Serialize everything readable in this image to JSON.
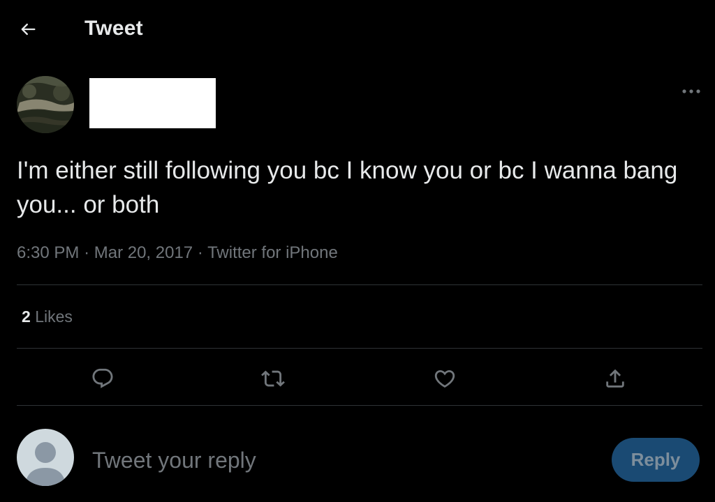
{
  "header": {
    "title": "Tweet",
    "back_icon": "arrow-left-icon"
  },
  "tweet": {
    "avatar_icon": "profile-photo",
    "text": "I'm either still following you bc I know you or bc I wanna bang you... or both",
    "time": "6:30 PM",
    "separator": "·",
    "date": "Mar 20, 2017",
    "source": "Twitter for iPhone",
    "more_icon": "more-horizontal-icon"
  },
  "stats": {
    "likes_count": "2",
    "likes_label": "Likes"
  },
  "actions": [
    {
      "icon": "reply-icon"
    },
    {
      "icon": "retweet-icon"
    },
    {
      "icon": "heart-icon"
    },
    {
      "icon": "share-icon"
    }
  ],
  "composer": {
    "placeholder": "Tweet your reply",
    "reply_label": "Reply",
    "avatar_icon": "default-avatar-icon"
  },
  "colors": {
    "background": "#000000",
    "text_primary": "#e7e9ea",
    "text_secondary": "#71767b",
    "divider": "#2f3336",
    "reply_button": "#1a4a73",
    "reply_button_text": "#7d8e9c"
  }
}
